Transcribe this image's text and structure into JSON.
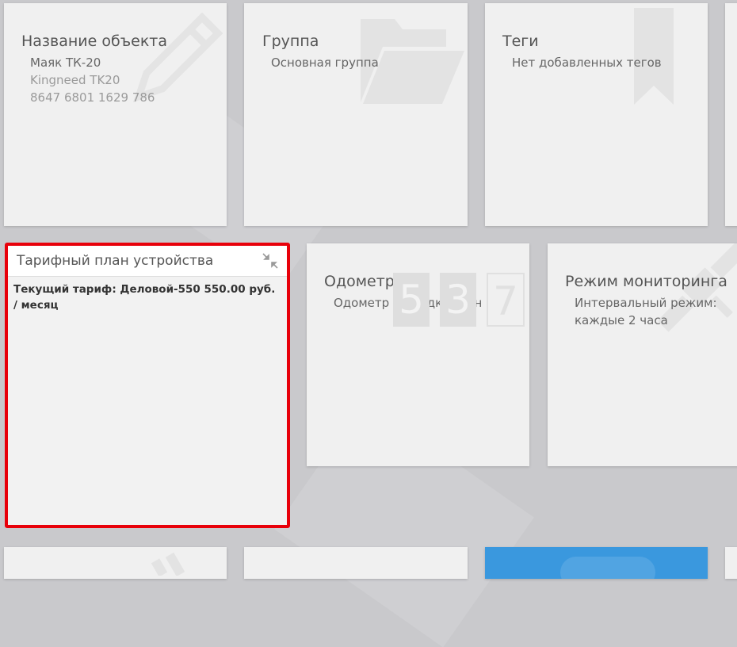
{
  "tiles": {
    "object_name": {
      "title": "Название объекта",
      "name": "Маяк ТК-20",
      "model": "Kingneed TK20",
      "imei": "8647 6801 1629 786"
    },
    "group": {
      "title": "Группа",
      "value": "Основная группа"
    },
    "tags": {
      "title": "Теги",
      "value": "Нет добавленных тегов"
    },
    "tariff": {
      "title": "Тарифный план устройства",
      "text": "Текущий тариф: Деловой-550 550.00 руб. / месяц"
    },
    "odometer": {
      "title": "Одометр",
      "value": "Одометр не подключен",
      "digits": [
        "5",
        "3",
        "7"
      ]
    },
    "monitoring": {
      "title": "Режим мониторинга",
      "line1": "Интервальный режим:",
      "line2": "каждые 2 часа"
    }
  },
  "colors": {
    "background": "#c9c9cc",
    "tile": "#f0f0f0",
    "highlight_border": "#e8000a",
    "accent_tile": "#3a98de"
  },
  "icons": [
    "pencil-icon",
    "folder-icon",
    "bookmark-icon",
    "collapse-icon",
    "satellite-icon"
  ]
}
